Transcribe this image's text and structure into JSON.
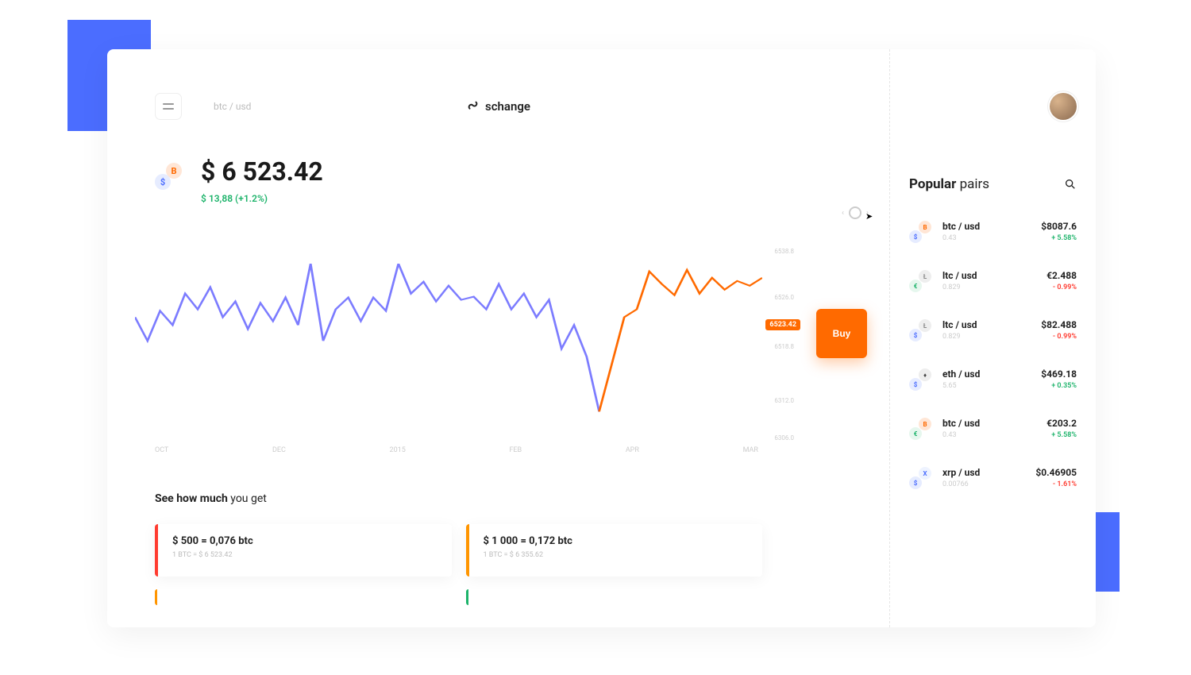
{
  "header": {
    "breadcrumb": "btc / usd",
    "logo": "schange"
  },
  "price": {
    "main": "$ 6 523.42",
    "delta": "$ 13,88 (+1.2%)"
  },
  "chart_data": {
    "type": "line",
    "xlabel": "",
    "ylabel": "",
    "ylim": [
      6306,
      6538
    ],
    "x_categories": [
      "OCT",
      "DEC",
      "2015",
      "FEB",
      "APR",
      "MAR"
    ],
    "y_ticks": [
      "6538.8",
      "6526.0",
      "6518.8",
      "6312.0",
      "6306.0"
    ],
    "current_price_tag": "6523.42",
    "series": [
      {
        "name": "historical",
        "color": "#7c7cff",
        "x": [
          0,
          2,
          4,
          6,
          8,
          10,
          12,
          14,
          16,
          18,
          20,
          22,
          24,
          26,
          28,
          30,
          32,
          34,
          36,
          38,
          40,
          42,
          44,
          46,
          48,
          50,
          52,
          54,
          56,
          58,
          60,
          62,
          64,
          66,
          68,
          70,
          72,
          74
        ],
        "values": [
          6470,
          6440,
          6478,
          6460,
          6500,
          6480,
          6508,
          6470,
          6490,
          6455,
          6488,
          6465,
          6495,
          6460,
          6538,
          6440,
          6480,
          6495,
          6465,
          6495,
          6478,
          6538,
          6500,
          6515,
          6490,
          6510,
          6492,
          6496,
          6480,
          6512,
          6480,
          6500,
          6470,
          6492,
          6430,
          6460,
          6420,
          6350
        ]
      },
      {
        "name": "current",
        "color": "#ff6a00",
        "x": [
          74,
          76,
          78,
          80,
          82,
          84,
          86,
          88,
          90,
          92,
          94,
          96,
          98,
          100
        ],
        "values": [
          6350,
          6410,
          6470,
          6480,
          6528,
          6512,
          6498,
          6530,
          6500,
          6520,
          6505,
          6516,
          6510,
          6520
        ]
      }
    ]
  },
  "buy_label": "Buy",
  "converter": {
    "title_bold": "See how much",
    "title_rest": " you get",
    "cards": [
      {
        "bar": "red",
        "eq": "$ 500  =  0,076 btc",
        "rate": "1 BTC = $ 6 523.42"
      },
      {
        "bar": "orange",
        "eq": "$ 1 000  =  0,172 btc",
        "rate": "1 BTC = $ 6 355.62"
      }
    ],
    "stubs": [
      {
        "bar": "orange"
      },
      {
        "bar": "green"
      }
    ]
  },
  "side": {
    "title_bold": "Popular",
    "title_rest": " pairs",
    "pairs": [
      {
        "ic1": "ic-btc",
        "s1": "B",
        "ic2": "ic-usd",
        "s2": "$",
        "name": "btc / usd",
        "sub": "0.43",
        "price": "$8087.6",
        "delta": "+ 5.58%",
        "dir": "pos"
      },
      {
        "ic1": "ic-ltc",
        "s1": "Ł",
        "ic2": "ic-eur",
        "s2": "€",
        "name": "ltc / usd",
        "sub": "0.829",
        "price": "€2.488",
        "delta": "- 0.99%",
        "dir": "neg"
      },
      {
        "ic1": "ic-ltc",
        "s1": "Ł",
        "ic2": "ic-usd",
        "s2": "$",
        "name": "ltc / usd",
        "sub": "0.829",
        "price": "$82.488",
        "delta": "- 0.99%",
        "dir": "neg"
      },
      {
        "ic1": "ic-eth",
        "s1": "♦",
        "ic2": "ic-usd",
        "s2": "$",
        "name": "eth / usd",
        "sub": "5.65",
        "price": "$469.18",
        "delta": "+ 0.35%",
        "dir": "pos"
      },
      {
        "ic1": "ic-btc",
        "s1": "B",
        "ic2": "ic-eur",
        "s2": "€",
        "name": "btc / usd",
        "sub": "0.43",
        "price": "€203.2",
        "delta": "+ 5.58%",
        "dir": "pos"
      },
      {
        "ic1": "ic-xrp",
        "s1": "X",
        "ic2": "ic-usd",
        "s2": "$",
        "name": "xrp / usd",
        "sub": "0.00766",
        "price": "$0.46905",
        "delta": "- 1.61%",
        "dir": "neg"
      }
    ]
  }
}
